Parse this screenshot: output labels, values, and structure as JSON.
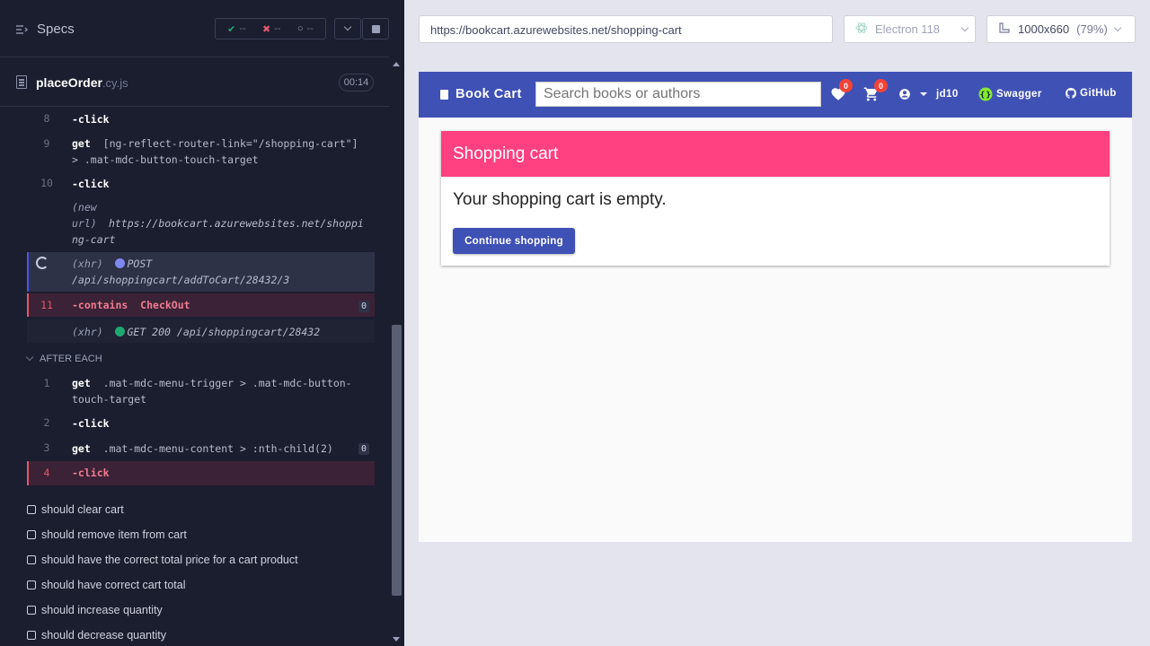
{
  "reporter": {
    "title": "Specs",
    "stats": {
      "passed": "--",
      "failed": "--",
      "pending": "--"
    },
    "spec_file": {
      "name": "placeOrder",
      "ext": ".cy.js",
      "duration": "00:14"
    },
    "commands": [
      {
        "num": "8",
        "kw": "-click",
        "text": ""
      },
      {
        "num": "9",
        "kw": "get",
        "text": "[ng-reflect-router-link=\"/shopping-cart\"] > .mat-mdc-button-touch-target"
      },
      {
        "num": "10",
        "kw": "-click",
        "text": ""
      },
      {
        "num": "",
        "kw": "(new url)",
        "text": "https://bookcart.azurewebsites.net/shopping-cart"
      },
      {
        "num": "",
        "kw": "(xhr)",
        "method": "POST",
        "text": "/api/shoppingcart/addToCart/28432/3"
      },
      {
        "num": "11",
        "kw": "-contains",
        "text": "CheckOut",
        "count": "0"
      },
      {
        "num": "",
        "kw": "(xhr)",
        "method": "GET 200",
        "text": "/api/shoppingcart/28432"
      }
    ],
    "after_each_label": "AFTER EACH",
    "after_commands": [
      {
        "num": "1",
        "kw": "get",
        "text": ".mat-mdc-menu-trigger > .mat-mdc-button-touch-target"
      },
      {
        "num": "2",
        "kw": "-click",
        "text": ""
      },
      {
        "num": "3",
        "kw": "get",
        "text": ".mat-mdc-menu-content > :nth-child(2)",
        "count": "0"
      },
      {
        "num": "4",
        "kw": "-click",
        "text": ""
      }
    ],
    "tests": [
      "should clear cart",
      "should remove item from cart",
      "should have the correct total price for a cart product",
      "should have correct cart total",
      "should increase quantity",
      "should decrease quantity"
    ]
  },
  "topbar": {
    "url": "https://bookcart.azurewebsites.net/shopping-cart",
    "browser": "Electron 118",
    "viewport": "1000x660",
    "zoom": "(79%)"
  },
  "app": {
    "brand": "Book Cart",
    "search_placeholder": "Search books or authors",
    "wishlist_count": "0",
    "cart_count": "0",
    "user": "jd10",
    "swagger": "Swagger",
    "github": "GitHub",
    "card_title": "Shopping cart",
    "empty_message": "Your shopping cart is empty.",
    "continue_label": "Continue shopping"
  },
  "colors": {
    "primary": "#3f51b5",
    "accent": "#ff4081",
    "reporter_bg": "#1b1e2e",
    "failed": "#e45770",
    "passed": "#1fa971"
  }
}
